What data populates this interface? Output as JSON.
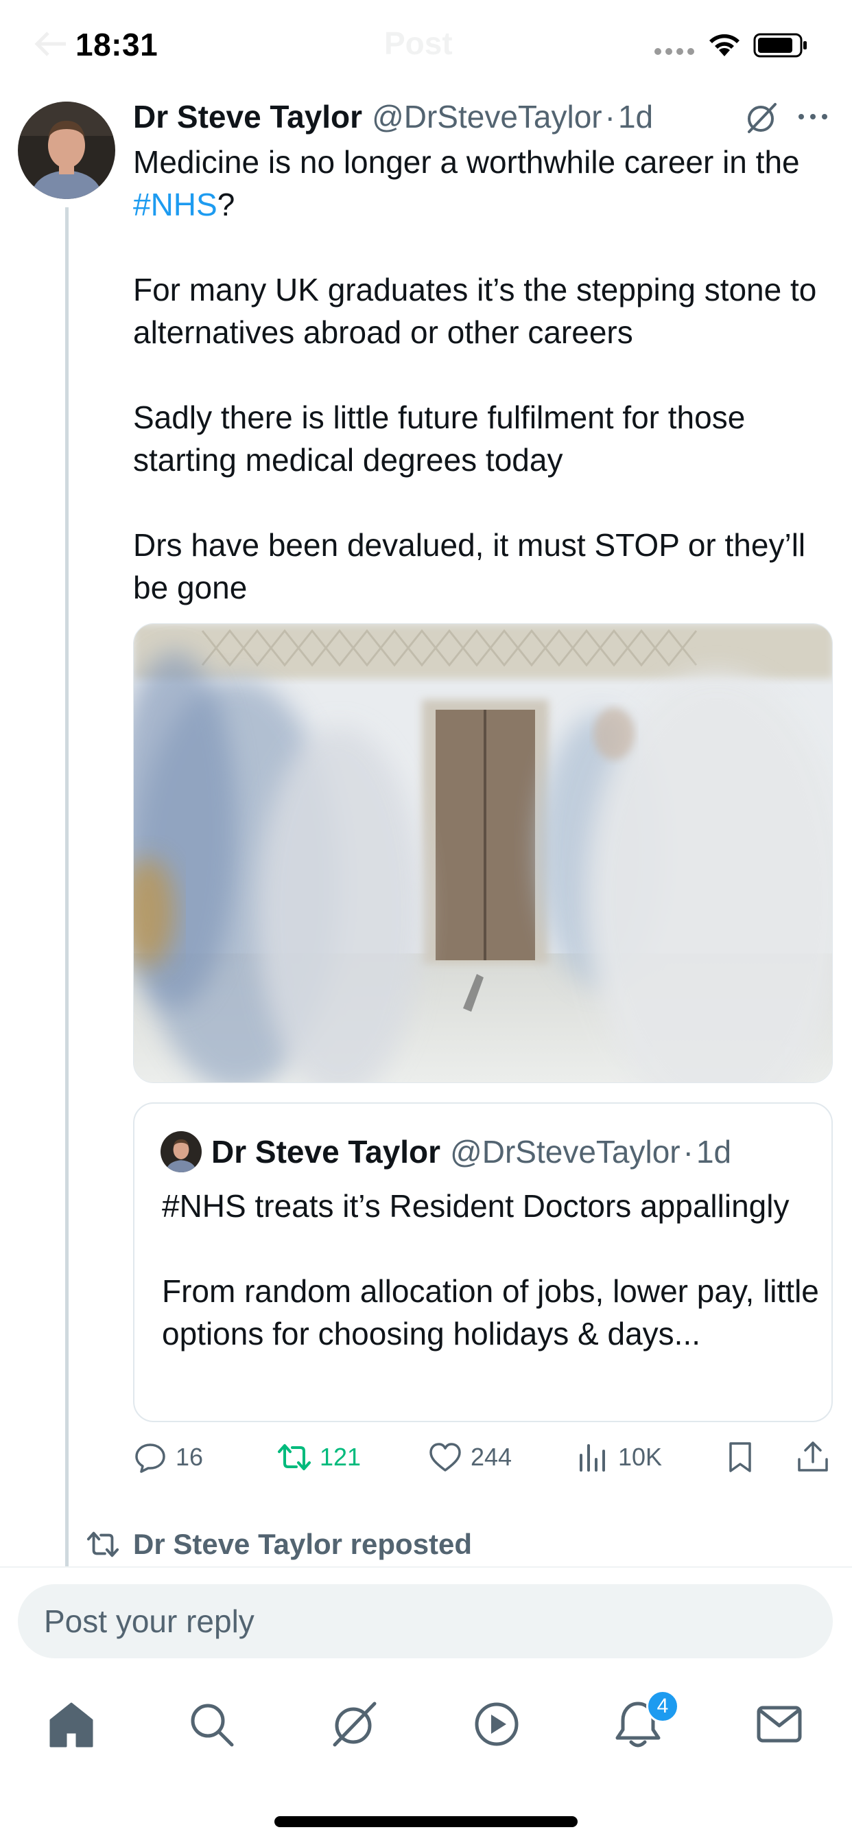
{
  "status_bar": {
    "time": "18:31",
    "page_title": "Post"
  },
  "tweet": {
    "author_name": "Dr Steve Taylor",
    "author_handle": "@DrSteveTaylor",
    "separator": "·",
    "time": "1d",
    "text_parts": {
      "line1": "Medicine is no longer a worthwhile career in the",
      "hashtag": "#NHS",
      "after_hashtag": "?",
      "para2": "For many UK graduates it’s the stepping stone to alternatives abroad or other careers",
      "para3": "Sadly there is little future fulfilment for those starting medical degrees today",
      "para4": "Drs have been devalued, it must STOP or they’ll be gone"
    },
    "media_description_icon": "photo-hospital-corridor"
  },
  "quote_tweet": {
    "author_name": "Dr Steve Taylor",
    "author_handle": "@DrSteveTaylor",
    "separator": "·",
    "time": "1d",
    "para1": "#NHS treats it’s Resident Doctors appallingly",
    "para2": "From random allocation of jobs, lower pay, little options for choosing holidays & days..."
  },
  "actions": {
    "replies": "16",
    "retweets": "121",
    "likes": "244",
    "views": "10K"
  },
  "reposted_label": "Dr Steve Taylor reposted",
  "reply_placeholder": "Post your reply",
  "bottom_nav": {
    "items": [
      "home-icon",
      "search-icon",
      "grok-icon",
      "video-icon",
      "notifications-icon",
      "messages-icon"
    ],
    "notification_count": "4"
  },
  "colors": {
    "accent": "#1d9bf0",
    "retweet_green": "#00ba7c",
    "muted": "#536471",
    "text": "#0f1419"
  }
}
